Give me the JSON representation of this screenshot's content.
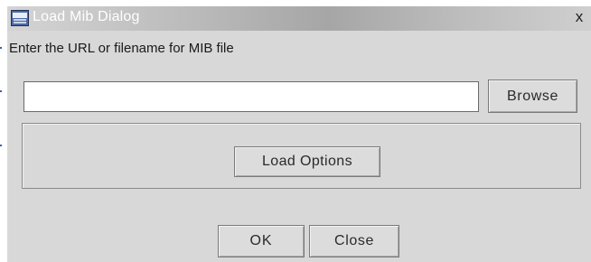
{
  "window": {
    "title": "Load Mib Dialog",
    "close_glyph": "x",
    "icon": "app-window-icon"
  },
  "form": {
    "instruction": "Enter the URL or filename for MIB file",
    "url_value": "",
    "url_placeholder": ""
  },
  "buttons": {
    "browse": "Browse",
    "load_options": "Load Options",
    "ok": "OK",
    "close": "Close"
  },
  "colors": {
    "dialog_background": "#d8d8d8",
    "title_text": "#ffffff"
  }
}
